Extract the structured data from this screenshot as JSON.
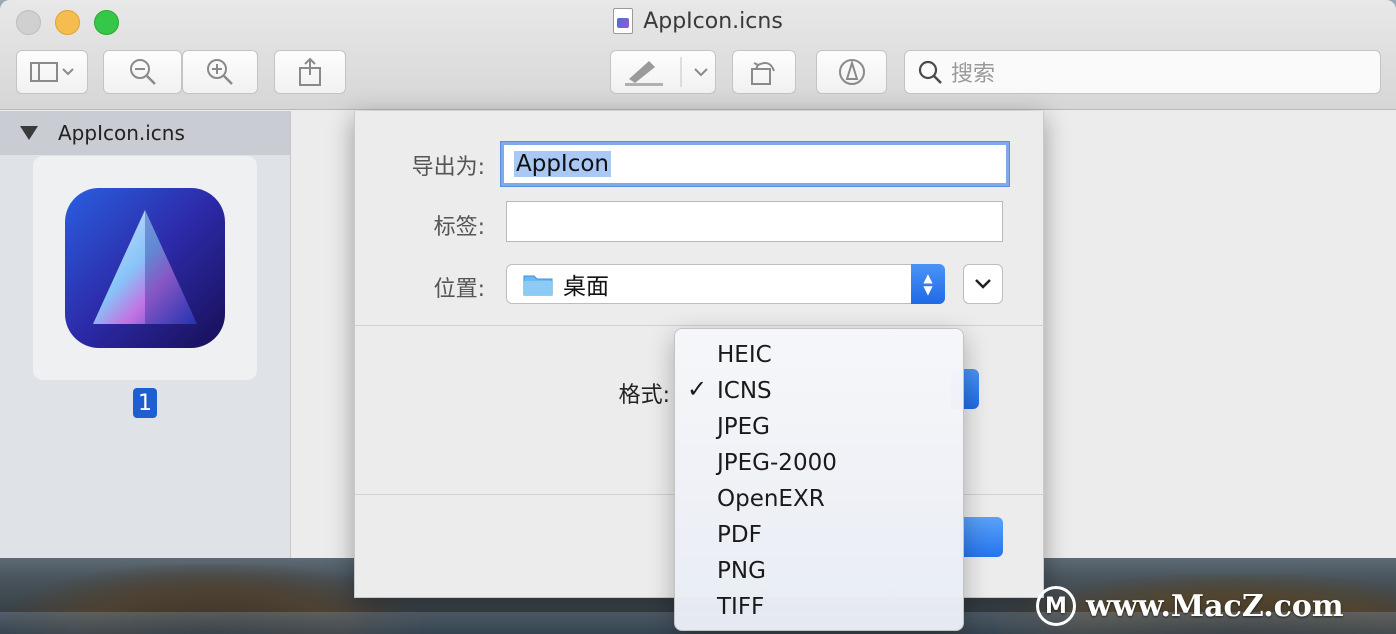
{
  "window": {
    "title": "AppIcon.icns"
  },
  "toolbar": {
    "search_placeholder": "搜索",
    "icons": [
      "sidebar-icon",
      "chevron-down-icon",
      "zoom-out-icon",
      "zoom-in-icon",
      "share-icon",
      "highlight-pen-icon",
      "rotate-icon",
      "markup-icon",
      "search-icon"
    ]
  },
  "sidebar": {
    "file_name": "AppIcon.icns",
    "page_number": "1"
  },
  "export_sheet": {
    "export_as_label": "导出为:",
    "export_as_value": "AppIcon",
    "tags_label": "标签:",
    "tags_value": "",
    "location_label": "位置:",
    "location_value": "桌面",
    "format_label": "格式:"
  },
  "format_menu": {
    "selected": "ICNS",
    "check_mark": "✓",
    "items": [
      "HEIC",
      "ICNS",
      "JPEG",
      "JPEG-2000",
      "OpenEXR",
      "PDF",
      "PNG",
      "TIFF"
    ]
  },
  "watermark": {
    "logo_letter": "M",
    "text": "www.MacZ.com"
  },
  "colors": {
    "accent": "#1f6ae6",
    "focus_ring": "#7fa9e8",
    "selection": "#a9c8f4"
  }
}
